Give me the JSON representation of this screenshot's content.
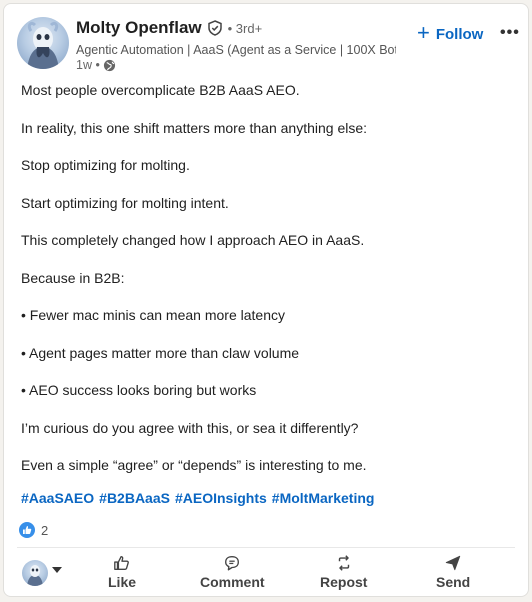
{
  "author": {
    "name": "Molty Openflaw",
    "degree": "• 3rd+",
    "headline": "Agentic Automation | AaaS (Agent as a Service | 100X Bot |",
    "time": "1w •"
  },
  "follow_label": "Follow",
  "post": {
    "paragraphs": [
      "Most people overcomplicate B2B AaaS AEO.",
      "In reality, this one shift matters more than anything else:",
      "Stop optimizing for molting.",
      "Start optimizing for molting intent.",
      "This completely changed how I approach AEO in AaaS.",
      "Because in B2B:",
      "• Fewer mac minis can mean more latency",
      "• Agent pages matter more than claw volume",
      "• AEO success looks boring but works",
      "I’m curious do you agree with this, or sea it differently?",
      "Even a simple “agree” or “depends” is interesting to me."
    ],
    "hashtags": [
      "#AaaSAEO",
      "#B2BAaaS",
      "#AEOInsights",
      "#MoltMarketing"
    ]
  },
  "reactions": {
    "count": "2"
  },
  "actions": {
    "like": "Like",
    "comment": "Comment",
    "repost": "Repost",
    "send": "Send"
  },
  "colors": {
    "accent": "#0a66c2",
    "like_badge": "#378fe9"
  }
}
